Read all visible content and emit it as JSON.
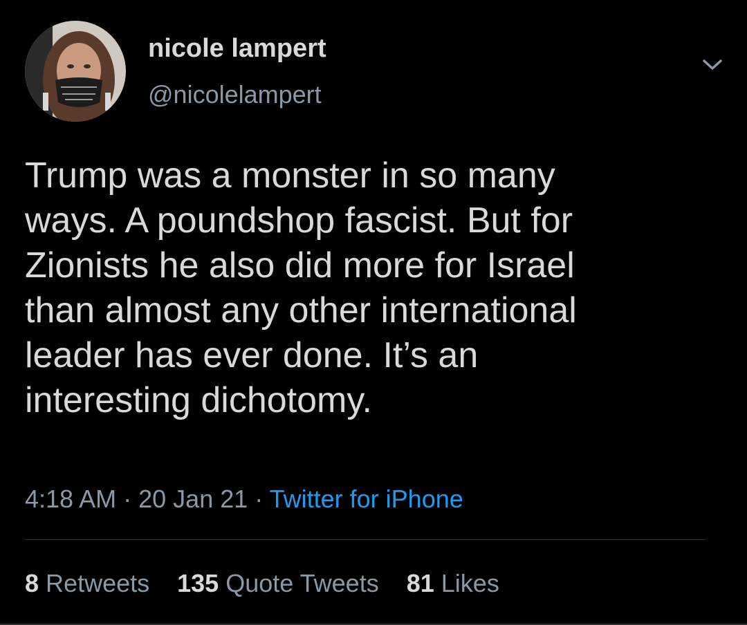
{
  "author": {
    "display_name": "nicole lampert",
    "handle": "@nicolelampert",
    "avatar_icon": "user-avatar-photo"
  },
  "menu_icon": "chevron-down-icon",
  "tweet": {
    "text": "Trump was a monster in so many\nways. A poundshop fascist. But for\nZionists he also did more for Israel\nthan almost any other international\nleader has ever done. It’s an\ninteresting dichotomy.",
    "time": "4:18 AM",
    "date": "20 Jan 21",
    "separator": "·",
    "source": "Twitter for iPhone"
  },
  "stats": {
    "retweets_count": "8",
    "retweets_label": "Retweets",
    "quotes_count": "135",
    "quotes_label": "Quote Tweets",
    "likes_count": "81",
    "likes_label": "Likes"
  },
  "colors": {
    "background": "#000000",
    "primary_text": "#d9d9d9",
    "secondary_text": "#8b98a5",
    "link": "#1d9bf0",
    "divider": "#2f3336"
  }
}
